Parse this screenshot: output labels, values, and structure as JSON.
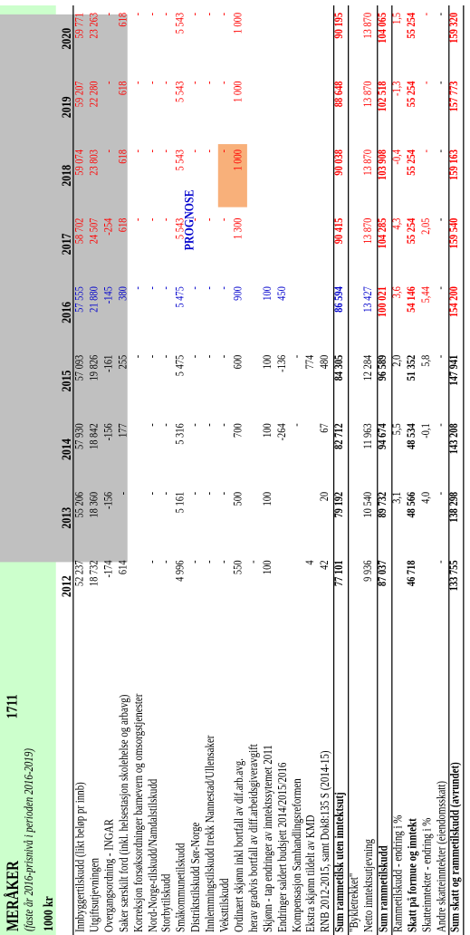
{
  "title": "MERÅKER",
  "code": "1711",
  "subtitle": "(faste år 2016-prisnivå i perioden 2016-2019)",
  "unit_label": "1000 kr",
  "prognose_label": "PROGNOSE",
  "years": [
    "2012",
    "2013",
    "2014",
    "2015",
    "2016",
    "2017",
    "2018",
    "2019",
    "2020"
  ],
  "rows": [
    {
      "label": "Innbyggertilskudd (likt beløp pr innb)",
      "values": [
        "52 237",
        "55 206",
        "57 930",
        "57 093",
        "57 555",
        "58 702",
        "59 074",
        "59 207",
        "59 771"
      ]
    },
    {
      "label": "Utgiftsutjevningen",
      "values": [
        "18 732",
        "18 360",
        "18 842",
        "19 826",
        "21 880",
        "24 507",
        "23 803",
        "22 280",
        "23 263"
      ]
    },
    {
      "label": "Overgangsordning - INGAR",
      "values": [
        "-174",
        "-156",
        "-156",
        "-161",
        "-145",
        "-254",
        "-",
        "-",
        "-"
      ]
    },
    {
      "label": "Saker særskilt ford (inkl. helsestasjon skolehelse og arbavg)",
      "values": [
        "614",
        "-",
        "177",
        "255",
        "380",
        "618",
        "618",
        "618",
        "618"
      ]
    },
    {
      "label": "Korreksjon forsøksordninger barnevern og omsorgstjenester",
      "values": [
        "",
        "",
        "",
        "-",
        "-",
        "-",
        "-",
        "-",
        "-"
      ]
    },
    {
      "label": "Nord-Norge-tilskudd/Namdalstilskudd",
      "values": [
        "-",
        "-",
        "-",
        "-",
        "-",
        "-",
        "-",
        "-",
        "-"
      ]
    },
    {
      "label": "Storbytilskudd",
      "values": [
        "-",
        "-",
        "-",
        "-",
        "-",
        "-",
        "-",
        "-",
        "-"
      ]
    },
    {
      "label": "Småkommunetilskudd",
      "values": [
        "4 996",
        "5 161",
        "5 316",
        "5 475",
        "5 475",
        "5 543",
        "5 543",
        "5 543",
        "5 543"
      ]
    },
    {
      "label": "Distriktstilskudd Sør-Norge",
      "values": [
        "-",
        "-",
        "-",
        "-",
        "-",
        "-",
        "-",
        "-",
        "-"
      ]
    },
    {
      "label": "Innlemmingstilskudd trekk Nannestad/Ullensaker",
      "values": [
        "-",
        "-",
        "-",
        "-",
        "-",
        "-",
        "-",
        "-",
        "-"
      ]
    },
    {
      "label": "Veksttilskudd",
      "values": [
        "-",
        "-",
        "-",
        "-",
        "-",
        "-",
        "-",
        "-",
        "-"
      ]
    },
    {
      "label": "Ordinært skjønn inkl bortfall av dif.arb.avg.",
      "values": [
        "550",
        "500",
        "700",
        "600",
        "900",
        "1 300",
        "1 000",
        "1 000",
        "1 000"
      ]
    },
    {
      "label": "  herav gradvis bortfall av diff.arbeidsgiveravgift",
      "values": [
        "-",
        "",
        "",
        "",
        "",
        "",
        "",
        "",
        ""
      ]
    },
    {
      "label": "Skjønn - tap endringer av inntektssytemet 2011",
      "values": [
        "100",
        "100",
        "100",
        "100",
        "100",
        "",
        "",
        "",
        ""
      ]
    },
    {
      "label": "Endringer saldert budsjett 2014/2015/2016",
      "values": [
        "",
        "",
        "-264",
        "-136",
        "450",
        "",
        "",
        "",
        ""
      ]
    },
    {
      "label": "Kompensasjon Samhandlingsreformen",
      "values": [
        "",
        "",
        "-",
        "-",
        "",
        "",
        "",
        "",
        ""
      ]
    },
    {
      "label": "Ekstra skjønn tildelt av KMD",
      "values": [
        "4",
        "",
        "",
        "774",
        "",
        "",
        "",
        "",
        ""
      ]
    },
    {
      "label": "RNB 2012-2015, samt Dok8:135 S (2014-15)",
      "values": [
        "42",
        "20",
        "67",
        "480",
        "",
        "",
        "",
        "",
        ""
      ]
    },
    {
      "label": "Sum rammetilsk uten inntektsutj",
      "values": [
        "77 101",
        "79 192",
        "82 712",
        "84 305",
        "86 594",
        "90 415",
        "90 038",
        "88 648",
        "90 195"
      ]
    },
    {
      "label": "\"Bykletrekket\"",
      "values": [
        "",
        "",
        "",
        "",
        "",
        "",
        "",
        "",
        ""
      ]
    },
    {
      "label": "Netto inntektsutjevning",
      "values": [
        "9 936",
        "10 540",
        "11 963",
        "12 284",
        "13 427",
        "13 870",
        "13 870",
        "13 870",
        "13 870"
      ]
    },
    {
      "label": "Sum rammetilskudd",
      "values": [
        "87 037",
        "89 732",
        "94 674",
        "96 589",
        "100 021",
        "104 285",
        "103 908",
        "102 518",
        "104 065"
      ]
    },
    {
      "label": "Rammetilskudd - endring i %",
      "values": [
        "",
        "3,1",
        "5,5",
        "2,0",
        "3,6",
        "4,3",
        "-0,4",
        "-1,3",
        "1,5"
      ]
    },
    {
      "label": "Skatt på formue og inntekt",
      "values": [
        "46 718",
        "48 566",
        "48 534",
        "51 352",
        "54 146",
        "55 254",
        "55 254",
        "55 254",
        "55 254"
      ]
    },
    {
      "label": "Skatteinntekter - endring i %",
      "values": [
        "",
        "4,0",
        "-0,1",
        "5,8",
        "5,44",
        "2,05",
        "-",
        "-",
        "-"
      ]
    },
    {
      "label": "Andre skatteinntekter (eiendomsskatt)",
      "values": [
        "-",
        "-",
        "-",
        "-",
        "-",
        "-",
        "-",
        "-",
        "-"
      ]
    },
    {
      "label": "Sum skatt og rammetilskudd (avrundet)",
      "values": [
        "133 755",
        "138 298",
        "143 208",
        "147 941",
        "154 200",
        "159 540",
        "159 163",
        "157 773",
        "159 320"
      ]
    }
  ],
  "colors": {
    "green_band": "#ccffcc",
    "gray_panel": "#c0c0c0",
    "red": "#ff0000",
    "blue": "#0000cc",
    "peach": "#f8b07a",
    "peach_light": "#fde3cf",
    "marker": "#008000"
  }
}
